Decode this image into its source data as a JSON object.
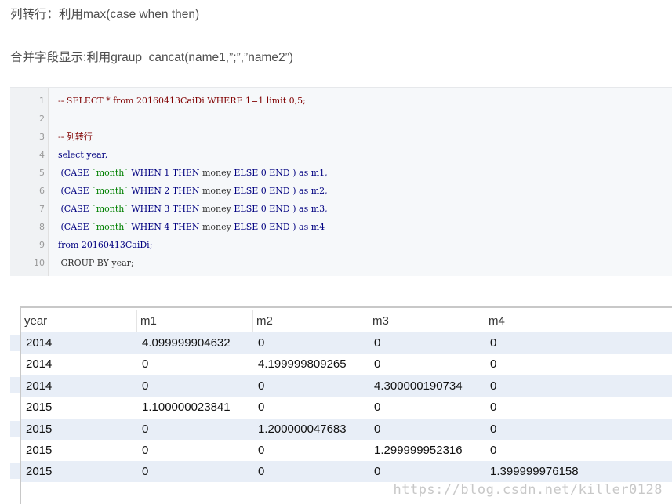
{
  "text": {
    "line1": "列转行：利用max(case when then)",
    "line2": "合并字段显示:利用graup_cancat(name1,”;”,”name2”)"
  },
  "code": {
    "lines": [
      {
        "n": "1",
        "parts": [
          {
            "t": "-- SELECT * from 20160413CaiDi WHERE 1=1 limit 0,5;",
            "k": "comment"
          }
        ]
      },
      {
        "n": "2",
        "parts": []
      },
      {
        "n": "3",
        "parts": [
          {
            "t": "-- 列转行",
            "k": "comment"
          }
        ]
      },
      {
        "n": "4",
        "parts": [
          {
            "t": "select year,",
            "k": "kw"
          }
        ]
      },
      {
        "n": "5",
        "parts": [
          {
            "t": " (CASE ",
            "k": "kw"
          },
          {
            "t": "`month`",
            "k": "str"
          },
          {
            "t": " WHEN ",
            "k": "kw"
          },
          {
            "t": "1",
            "k": "num"
          },
          {
            "t": " THEN ",
            "k": "kw"
          },
          {
            "t": "money",
            "k": "plain"
          },
          {
            "t": " ELSE ",
            "k": "kw"
          },
          {
            "t": "0",
            "k": "num"
          },
          {
            "t": " END ) as m1,",
            "k": "kw"
          }
        ]
      },
      {
        "n": "6",
        "parts": [
          {
            "t": " (CASE ",
            "k": "kw"
          },
          {
            "t": "`month`",
            "k": "str"
          },
          {
            "t": " WHEN ",
            "k": "kw"
          },
          {
            "t": "2",
            "k": "num"
          },
          {
            "t": " THEN ",
            "k": "kw"
          },
          {
            "t": "money",
            "k": "plain"
          },
          {
            "t": " ELSE ",
            "k": "kw"
          },
          {
            "t": "0",
            "k": "num"
          },
          {
            "t": " END ) as m2,",
            "k": "kw"
          }
        ]
      },
      {
        "n": "7",
        "parts": [
          {
            "t": " (CASE ",
            "k": "kw"
          },
          {
            "t": "`month`",
            "k": "str"
          },
          {
            "t": " WHEN ",
            "k": "kw"
          },
          {
            "t": "3",
            "k": "num"
          },
          {
            "t": " THEN ",
            "k": "kw"
          },
          {
            "t": "money",
            "k": "plain"
          },
          {
            "t": " ELSE ",
            "k": "kw"
          },
          {
            "t": "0",
            "k": "num"
          },
          {
            "t": " END ) as m3,",
            "k": "kw"
          }
        ]
      },
      {
        "n": "8",
        "parts": [
          {
            "t": " (CASE ",
            "k": "kw"
          },
          {
            "t": "`month`",
            "k": "str"
          },
          {
            "t": " WHEN ",
            "k": "kw"
          },
          {
            "t": "4",
            "k": "num"
          },
          {
            "t": " THEN ",
            "k": "kw"
          },
          {
            "t": "money",
            "k": "plain"
          },
          {
            "t": " ELSE ",
            "k": "kw"
          },
          {
            "t": "0",
            "k": "num"
          },
          {
            "t": " END ) as m4",
            "k": "kw"
          }
        ]
      },
      {
        "n": "9",
        "parts": [
          {
            "t": "from 20160413CaiDi;",
            "k": "kw"
          }
        ]
      },
      {
        "n": "10",
        "parts": [
          {
            "t": " GROUP BY year;",
            "k": "plain"
          }
        ]
      }
    ]
  },
  "grid": {
    "columns": [
      "year",
      "m1",
      "m2",
      "m3",
      "m4"
    ],
    "rows": [
      [
        "2014",
        "4.099999904632",
        "0",
        "0",
        "0"
      ],
      [
        "2014",
        "0",
        "4.199999809265",
        "0",
        "0"
      ],
      [
        "2014",
        "0",
        "0",
        "4.300000190734",
        "0"
      ],
      [
        "2015",
        "1.100000023841",
        "0",
        "0",
        "0"
      ],
      [
        "2015",
        "0",
        "1.200000047683",
        "0",
        "0"
      ],
      [
        "2015",
        "0",
        "0",
        "1.299999952316",
        "0"
      ],
      [
        "2015",
        "0",
        "0",
        "0",
        "1.399999976158"
      ]
    ]
  },
  "watermark": "https://blog.csdn.net/killer0128"
}
